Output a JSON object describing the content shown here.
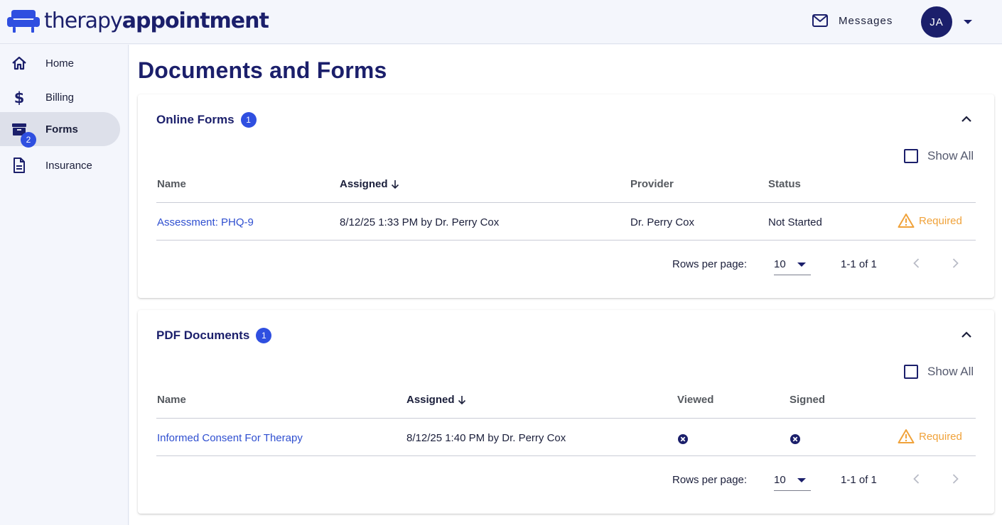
{
  "brand": {
    "name_light": "therapy",
    "name_bold": "appointment",
    "accent": "#2f4fe0",
    "navy": "#1b1f6b"
  },
  "header": {
    "messages_label": "Messages",
    "avatar_initials": "JA"
  },
  "sidebar": {
    "items": [
      {
        "label": "Home",
        "icon": "home-icon"
      },
      {
        "label": "Billing",
        "icon": "dollar-icon"
      },
      {
        "label": "Forms",
        "icon": "inbox-icon",
        "badge": "2",
        "active": true
      },
      {
        "label": "Insurance",
        "icon": "document-icon"
      }
    ]
  },
  "page": {
    "title": "Documents and Forms"
  },
  "online_forms": {
    "title": "Online Forms",
    "count": "1",
    "show_all_label": "Show All",
    "columns": [
      "Name",
      "Assigned",
      "Provider",
      "Status"
    ],
    "rows": [
      {
        "name": "Assessment: PHQ-9",
        "assigned": "8/12/25 1:33 PM by Dr. Perry Cox",
        "provider": "Dr. Perry Cox",
        "status": "Not Started",
        "flag": "Required"
      }
    ],
    "pager": {
      "rows_per_page_label": "Rows per page:",
      "rows_per_page": "10",
      "range": "1-1 of 1"
    }
  },
  "pdf_documents": {
    "title": "PDF Documents",
    "count": "1",
    "show_all_label": "Show All",
    "columns": [
      "Name",
      "Assigned",
      "Viewed",
      "Signed"
    ],
    "rows": [
      {
        "name": "Informed Consent For Therapy",
        "assigned": "8/12/25 1:40 PM by Dr. Perry Cox",
        "viewed": false,
        "signed": false,
        "flag": "Required"
      }
    ],
    "pager": {
      "rows_per_page_label": "Rows per page:",
      "rows_per_page": "10",
      "range": "1-1 of 1"
    }
  },
  "colors": {
    "required": "#f0a23a",
    "link": "#2f4fd0"
  }
}
